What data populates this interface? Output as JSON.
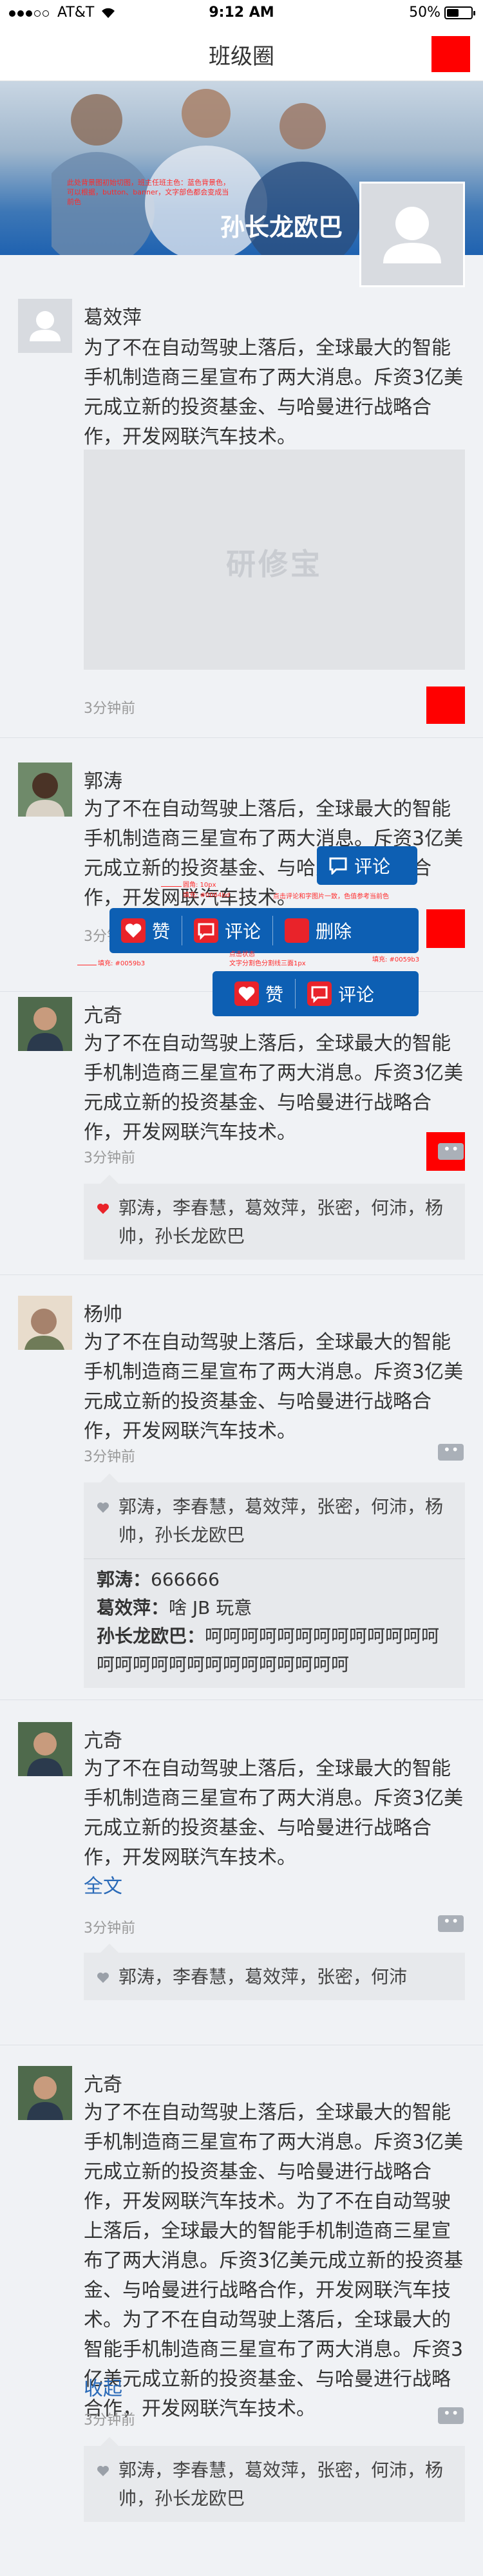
{
  "status_bar": {
    "carrier": "AT&T",
    "time": "9:12 AM",
    "battery": "50%",
    "battery_level": 0.5
  },
  "nav": {
    "title": "班级圈"
  },
  "banner": {
    "name": "孙长龙欧巴",
    "note": "此处背景图初始切图，班主任班主色：蓝色背景色，可以根据，button、banner，文字部色都会变成当前色"
  },
  "posts": [
    {
      "name": "葛效萍",
      "text": "为了不在自动驾驶上落后，全球最大的智能手机制造商三星宣布了两大消息。斥资3亿美元成立新的投资基金、与哈曼进行战略合作，开发网联汽车技术。",
      "image_watermark": "研修宝",
      "time": "3分钟前"
    },
    {
      "name": "郭涛",
      "text": "为了不在自动驾驶上落后，全球最大的智能手机制造商三星宣布了两大消息。斥资3亿美元成立新的投资基金、与哈曼进行战略合作，开发网联汽车技术。",
      "time": "3分钟前"
    },
    {
      "name": "亢奇",
      "text": "为了不在自动驾驶上落后，全球最大的智能手机制造商三星宣布了两大消息。斥资3亿美元成立新的投资基金、与哈曼进行战略合作，开发网联汽车技术。",
      "time": "3分钟前",
      "likes": "郭涛，李春慧，葛效萍，张密，何沛，杨帅，孙长龙欧巴"
    },
    {
      "name": "杨帅",
      "text": "为了不在自动驾驶上落后，全球最大的智能手机制造商三星宣布了两大消息。斥资3亿美元成立新的投资基金、与哈曼进行战略合作，开发网联汽车技术。",
      "time": "3分钟前",
      "likes": "郭涛，李春慧，葛效萍，张密，何沛，杨帅，孙长龙欧巴",
      "comments": [
        {
          "author": "郭涛：",
          "text": "666666"
        },
        {
          "author": "葛效萍：",
          "text": "啥 JB 玩意"
        },
        {
          "author": "孙长龙欧巴：",
          "text": "呵呵呵呵呵呵呵呵呵呵呵呵呵呵呵呵呵呵呵呵呵呵呵呵呵呵呵"
        }
      ]
    },
    {
      "name": "亢奇",
      "text": "为了不在自动驾驶上落后，全球最大的智能手机制造商三星宣布了两大消息。斥资3亿美元成立新的投资基金、与哈曼进行战略合作，开发网联汽车技术。",
      "link": "全文",
      "time": "3分钟前",
      "likes": "郭涛，李春慧，葛效萍，张密，何沛"
    },
    {
      "name": "亢奇",
      "text": "为了不在自动驾驶上落后，全球最大的智能手机制造商三星宣布了两大消息。斥资3亿美元成立新的投资基金、与哈曼进行战略合作，开发网联汽车技术。为了不在自动驾驶上落后，全球最大的智能手机制造商三星宣布了两大消息。斥资3亿美元成立新的投资基金、与哈曼进行战略合作，开发网联汽车技术。为了不在自动驾驶上落后，全球最大的智能手机制造商三星宣布了两大消息。斥资3亿美元成立新的投资基金、与哈曼进行战略合作，开发网联汽车技术。",
      "link": "收起",
      "time": "3分钟前",
      "likes": "郭涛，李春慧，葛效萍，张密，何沛，杨帅，孙长龙欧巴"
    }
  ],
  "popups": {
    "comment_only": {
      "comment": "评论"
    },
    "like_comment_delete": {
      "like": "赞",
      "comment": "评论",
      "delete": "删除"
    },
    "like_comment": {
      "like": "赞",
      "comment": "评论"
    }
  },
  "annotations": {
    "a1": "圆角: 10px",
    "a2": "填充: #0064bd",
    "a3": "点击评论和字图片一致，色值参考当前色",
    "a4": "填充: #0059b3",
    "a5": "点击状态",
    "a6": "文字分割色分割线三面1px",
    "a7": "填充: #0059b3"
  },
  "colors": {
    "accent": "#0d5fb3",
    "red_marker": "#ff0000",
    "link": "#2a6ab8",
    "banner_blue": "#1f62b0"
  }
}
